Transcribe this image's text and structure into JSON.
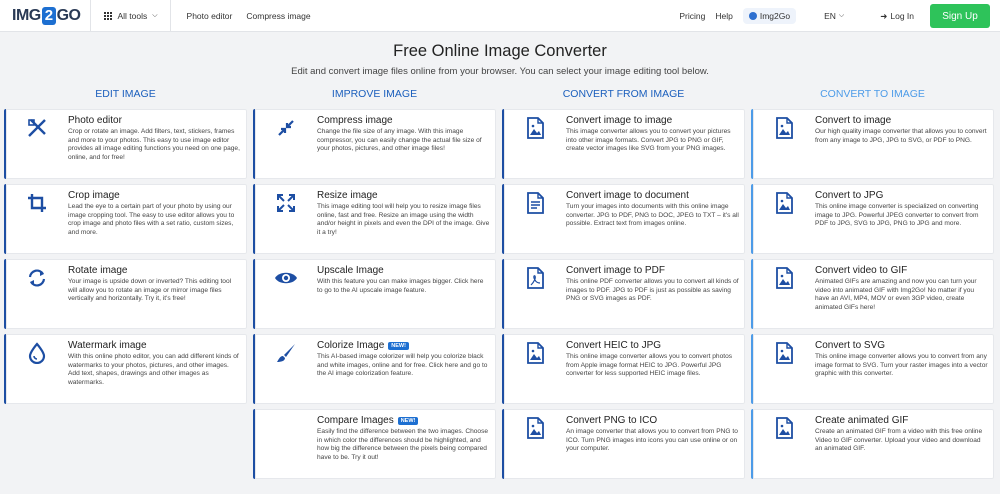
{
  "header": {
    "logo": {
      "pre": "IMG",
      "mid": "2",
      "post": "GO"
    },
    "all_tools": "All tools",
    "nav": [
      "Photo editor",
      "Compress image"
    ],
    "pricing": "Pricing",
    "help": "Help",
    "user": "Img2Go",
    "lang": "EN",
    "login": "Log In",
    "signup": "Sign Up"
  },
  "hero": {
    "title": "Free Online Image Converter",
    "subtitle": "Edit and convert image files online from your browser. You can select your image editing tool below."
  },
  "columns": [
    {
      "heading": "EDIT IMAGE",
      "cards": [
        {
          "icon": "photo-editor-icon",
          "title": "Photo editor",
          "desc": "Crop or rotate an image. Add filters, text, stickers, frames and more to your photos. This easy to use image editor provides all image editing functions you need on one page, online, and for free!"
        },
        {
          "icon": "crop-icon",
          "title": "Crop image",
          "desc": "Lead the eye to a certain part of your photo by using our image cropping tool. The easy to use editor allows you to crop image and photo files with a set ratio, custom sizes, and more."
        },
        {
          "icon": "rotate-icon",
          "title": "Rotate image",
          "desc": "Your image is upside down or inverted? This editing tool will allow you to rotate an image or mirror image files vertically and horizontally. Try it, it's free!"
        },
        {
          "icon": "watermark-icon",
          "title": "Watermark image",
          "desc": "With this online photo editor, you can add different kinds of watermarks to your photos, pictures, and other images. Add text, shapes, drawings and other images as watermarks."
        }
      ]
    },
    {
      "heading": "IMPROVE IMAGE",
      "cards": [
        {
          "icon": "compress-icon",
          "title": "Compress image",
          "desc": "Change the file size of any image. With this image compressor, you can easily change the actual file size of your photos, pictures, and other image files!"
        },
        {
          "icon": "resize-icon",
          "title": "Resize image",
          "desc": "This image editing tool will help you to resize image files online, fast and free. Resize an image using the width and/or height in pixels and even the DPI of the image. Give it a try!"
        },
        {
          "icon": "eye-icon",
          "title": "Upscale Image",
          "desc": "With this feature you can make images bigger. Click here to go to the AI upscale image feature."
        },
        {
          "icon": "brush-icon",
          "title": "Colorize Image",
          "badge": "NEW!",
          "desc": "This AI-based image colorizer will help you colorize black and white images, online and for free. Click here and go to the AI image colorization feature."
        },
        {
          "icon": "compare-icon",
          "title": "Compare Images",
          "badge": "NEW!",
          "desc": "Easily find the difference between the two images. Choose in which color the differences should be highlighted, and how big the difference between the pixels being compared have to be. Try it out!"
        }
      ]
    },
    {
      "heading": "CONVERT FROM IMAGE",
      "cards": [
        {
          "icon": "image-file-icon",
          "title": "Convert image to image",
          "desc": "This image converter allows you to convert your pictures into other image formats. Convert JPG to PNG or GIF, create vector images like SVG from your PNG images."
        },
        {
          "icon": "document-file-icon",
          "title": "Convert image to document",
          "desc": "Turn your images into documents with this online image converter. JPG to PDF, PNG to DOC, JPEG to TXT – it's all possible. Extract text from images online."
        },
        {
          "icon": "pdf-file-icon",
          "title": "Convert image to PDF",
          "desc": "This online PDF converter allows you to convert all kinds of images to PDF. JPG to PDF is just as possible as saving PNG or SVG images as PDF."
        },
        {
          "icon": "image-file-icon",
          "title": "Convert HEIC to JPG",
          "desc": "This online image converter allows you to convert photos from Apple image format HEIC to JPG. Powerful JPG converter for less supported HEIC image files."
        },
        {
          "icon": "image-file-icon",
          "title": "Convert PNG to ICO",
          "desc": "An image converter that allows you to convert from PNG to ICO. Turn PNG images into icons you can use online or on your computer."
        }
      ]
    },
    {
      "heading": "CONVERT TO IMAGE",
      "cards": [
        {
          "icon": "image-file-icon",
          "title": "Convert to image",
          "desc": "Our high quality image converter that allows you to convert from any image to JPG, JPG to SVG, or PDF to PNG."
        },
        {
          "icon": "image-file-icon",
          "title": "Convert to JPG",
          "desc": "This online image converter is specialized on converting image to JPG. Powerful JPEG converter to convert from PDF to JPG, SVG to JPG, PNG to JPG and more."
        },
        {
          "icon": "image-file-icon",
          "title": "Convert video to GIF",
          "desc": "Animated GIFs are amazing and now you can turn your video into animated GIF with Img2Go! No matter if you have an AVI, MP4, MOV or even 3GP video, create animated GIFs here!"
        },
        {
          "icon": "image-file-icon",
          "title": "Convert to SVG",
          "desc": "This online image converter allows you to convert from any image format to SVG. Turn your raster images into a vector graphic with this converter."
        },
        {
          "icon": "image-file-icon",
          "title": "Create animated GIF",
          "desc": "Create an animated GIF from a video with this free online Video to GIF converter. Upload your video and download an animated GIF."
        }
      ]
    }
  ],
  "colors": {
    "accent": "#1d6fd1",
    "dark_accent": "#1d4ea3",
    "light_accent": "#4c9be8",
    "signup": "#2ec35a"
  }
}
